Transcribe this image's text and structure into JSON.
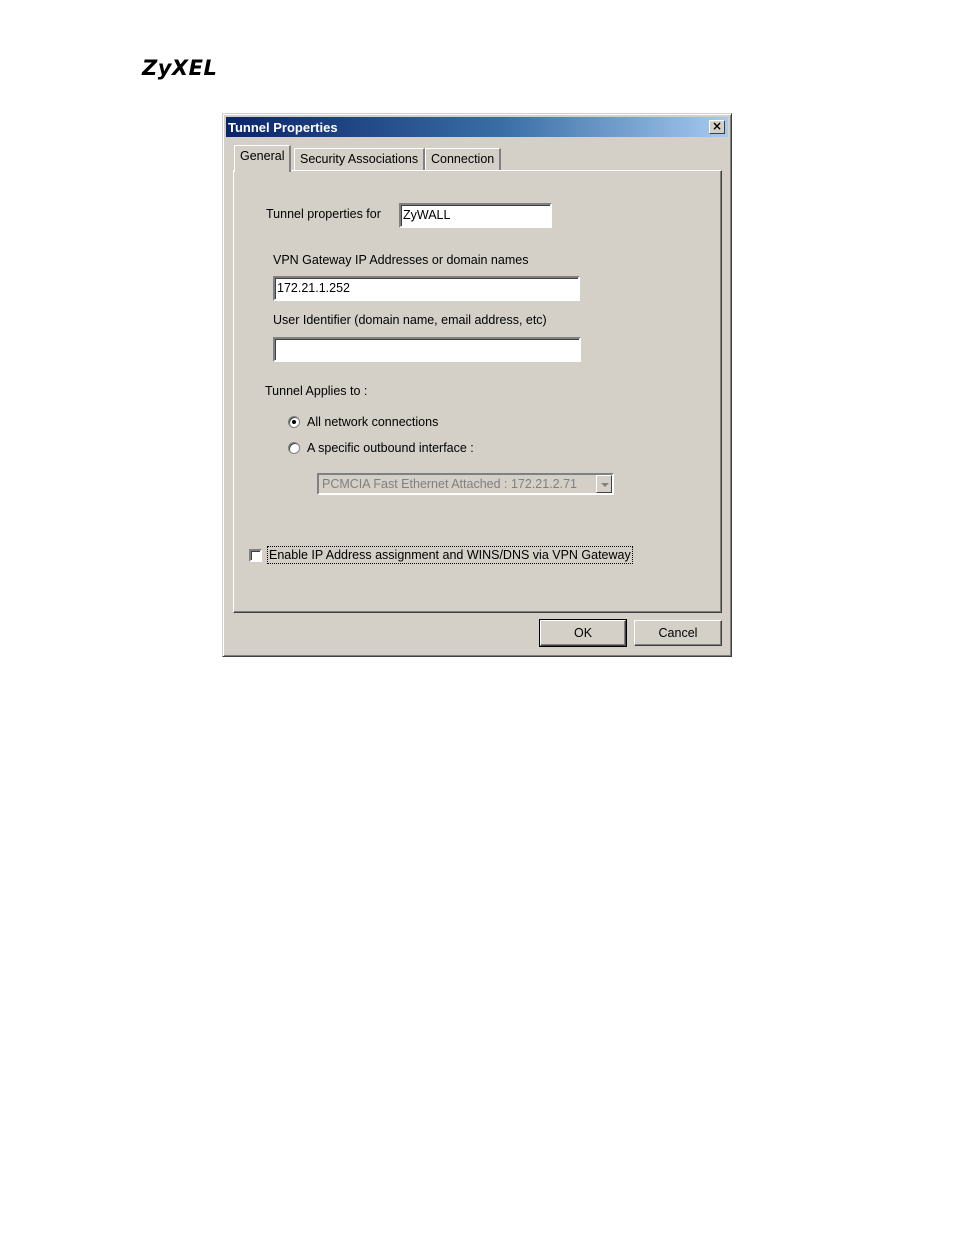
{
  "brand": {
    "logo_text": "ZyXEL"
  },
  "dialog": {
    "title": "Tunnel Properties",
    "close_symbol": "×",
    "tabs": [
      {
        "label": "General",
        "active": true
      },
      {
        "label": "Security Associations",
        "active": false
      },
      {
        "label": "Connection",
        "active": false
      }
    ],
    "general": {
      "tunnel_props_label": "Tunnel properties for",
      "tunnel_name": "ZyWALL",
      "gateway_label": "VPN Gateway IP Addresses or domain names",
      "gateway_value": "172.21.1.252",
      "user_id_label": "User Identifier (domain name, email address, etc)",
      "user_id_value": "",
      "applies_label": "Tunnel Applies to :",
      "radio_all": {
        "label": "All network connections",
        "checked": true
      },
      "radio_specific": {
        "label": "A specific outbound interface :",
        "checked": false
      },
      "interface_select": "PCMCIA Fast Ethernet Attached : 172.21.2.71",
      "enable_checkbox": {
        "label": "Enable IP Address assignment and WINS/DNS via VPN Gateway",
        "checked": false
      }
    },
    "buttons": {
      "ok": "OK",
      "cancel": "Cancel"
    }
  }
}
